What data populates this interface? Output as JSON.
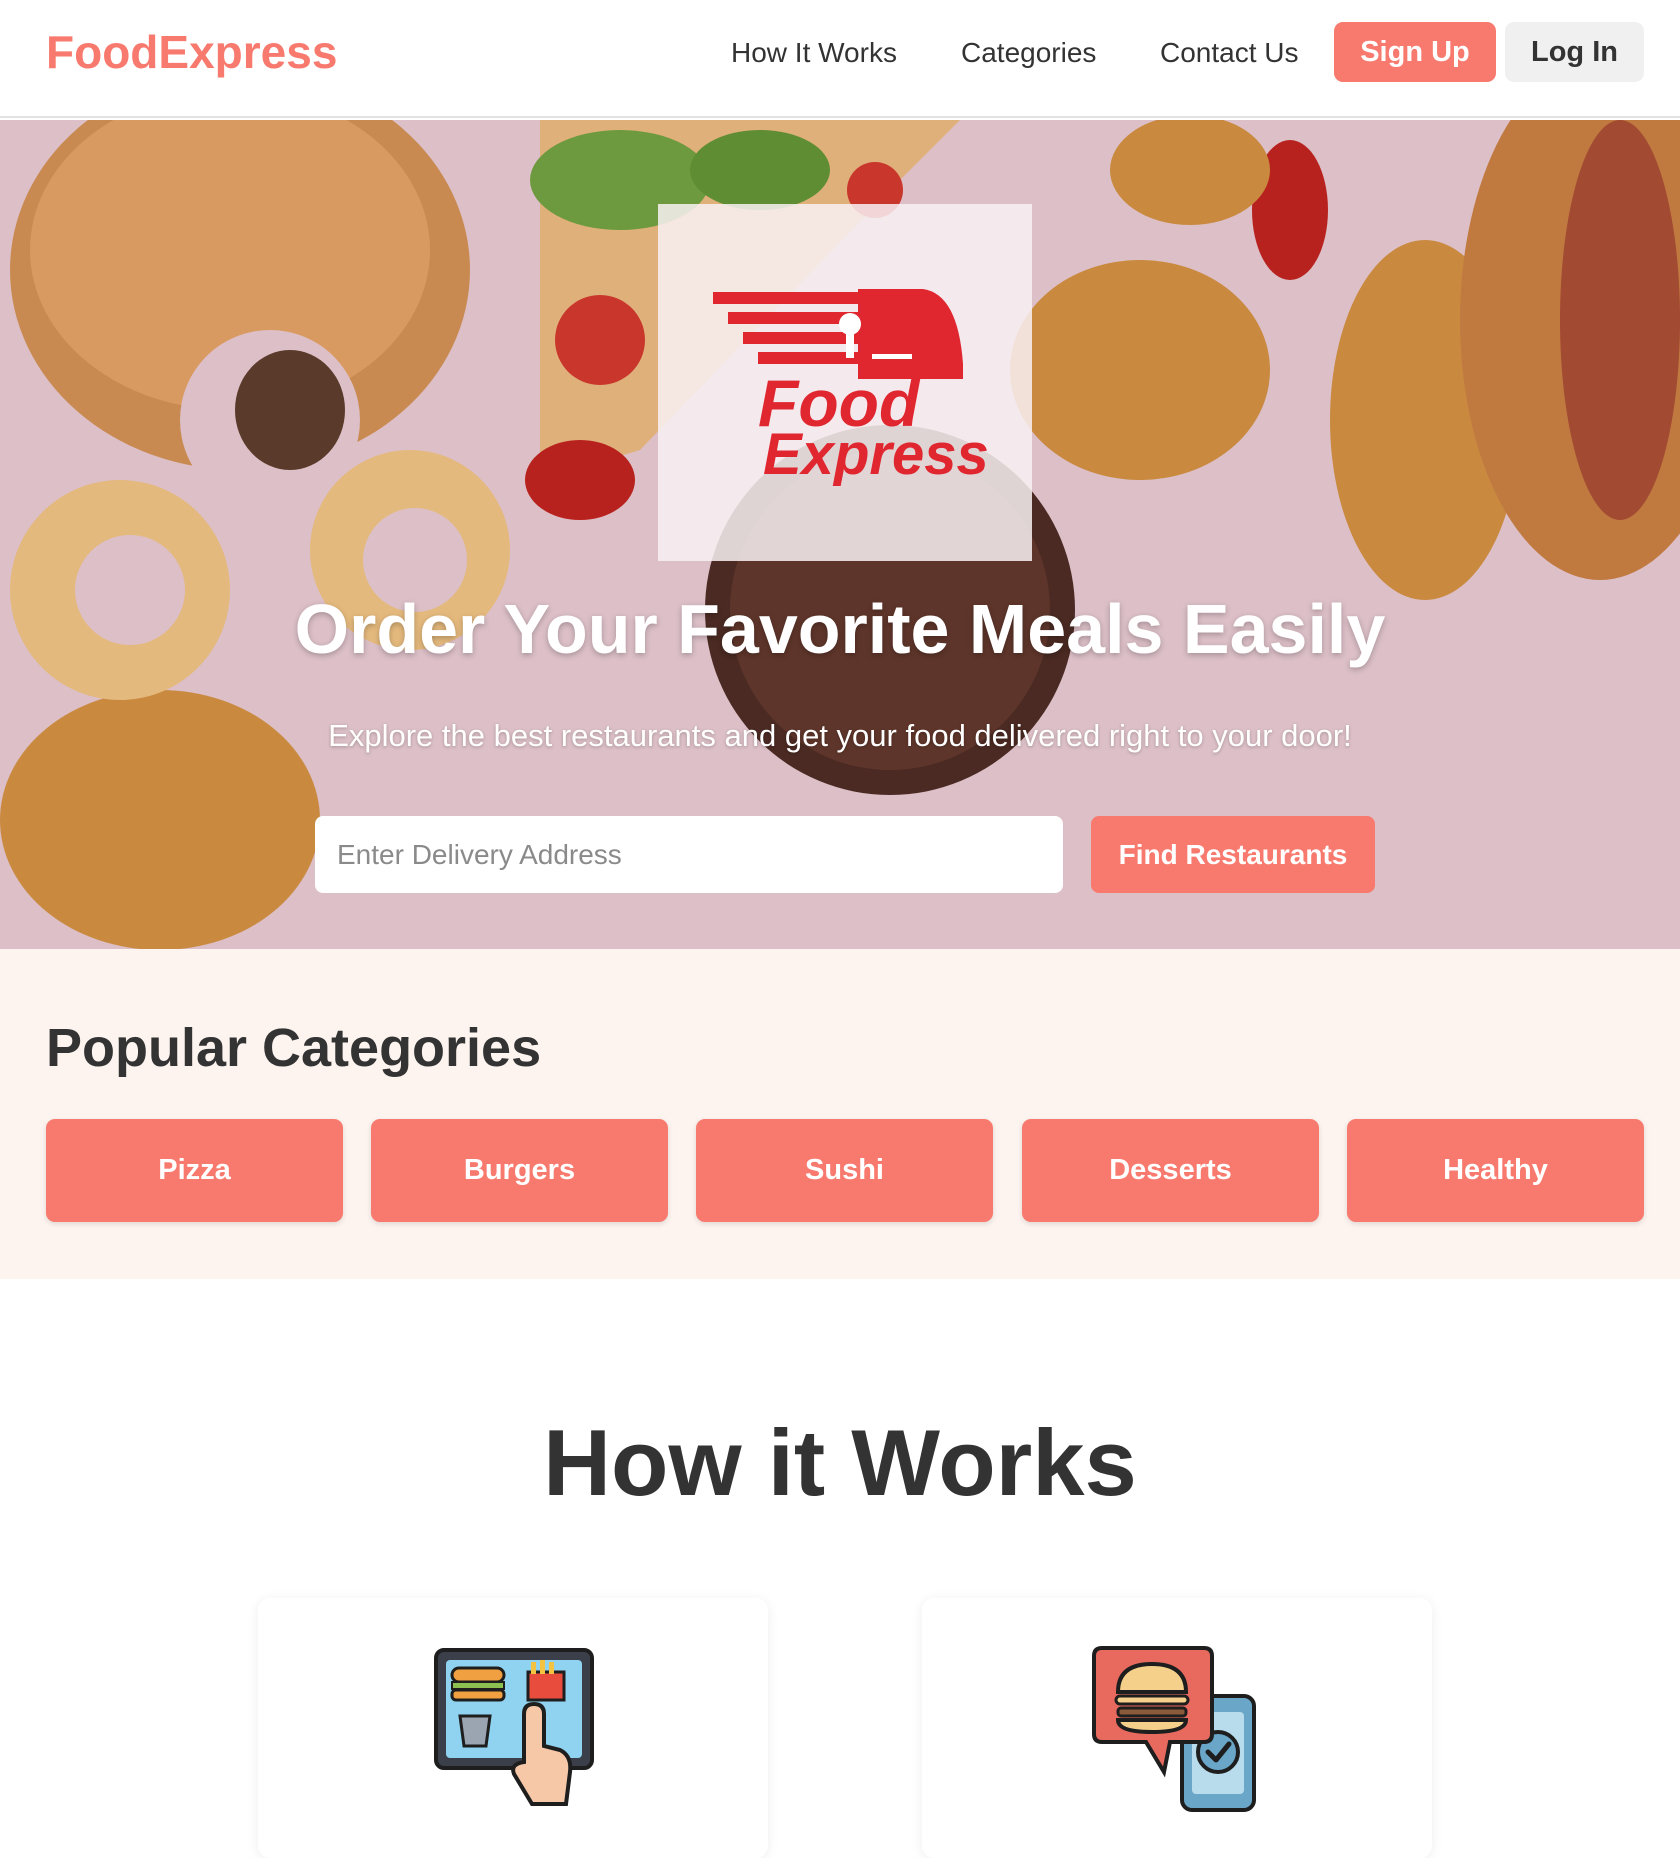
{
  "nav": {
    "brand": "FoodExpress",
    "links": [
      "How It Works",
      "Categories",
      "Contact Us"
    ],
    "signup_label": "Sign Up",
    "login_label": "Log In"
  },
  "hero": {
    "logo_line1": "Food",
    "logo_line2": "Express",
    "title": "Order Your Favorite Meals Easily",
    "subtitle": "Explore the best restaurants and get your food delivered right to your door!",
    "address_placeholder": "Enter Delivery Address",
    "find_label": "Find Restaurants"
  },
  "categories": {
    "title": "Popular Categories",
    "items": [
      "Pizza",
      "Burgers",
      "Sushi",
      "Desserts",
      "Healthy"
    ]
  },
  "how": {
    "title": "How it Works",
    "steps": [
      {
        "icon": "tablet-menu-order-icon"
      },
      {
        "icon": "chat-order-confirm-icon"
      }
    ]
  },
  "colors": {
    "accent": "#f87a6e",
    "text": "#333333",
    "category_bg": "#fdf4f0",
    "logo_red": "#e0262f"
  }
}
